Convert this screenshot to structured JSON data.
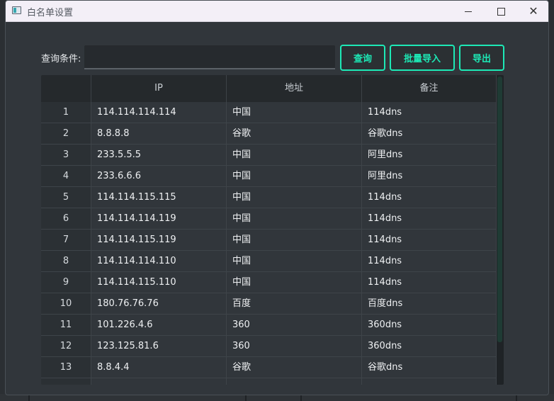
{
  "window": {
    "title": "白名单设置"
  },
  "query": {
    "label": "查询条件:",
    "value": "",
    "placeholder": "",
    "buttons": {
      "query": "查询",
      "batch_import": "批量导入",
      "export": "导出"
    }
  },
  "table": {
    "columns": [
      "IP",
      "地址",
      "备注"
    ],
    "rows": [
      {
        "index": "1",
        "ip": "114.114.114.114",
        "address": "中国",
        "note": "114dns"
      },
      {
        "index": "2",
        "ip": "8.8.8.8",
        "address": "谷歌",
        "note": "谷歌dns"
      },
      {
        "index": "3",
        "ip": "233.5.5.5",
        "address": "中国",
        "note": "阿里dns"
      },
      {
        "index": "4",
        "ip": "233.6.6.6",
        "address": "中国",
        "note": "阿里dns"
      },
      {
        "index": "5",
        "ip": "114.114.115.115",
        "address": "中国",
        "note": "114dns"
      },
      {
        "index": "6",
        "ip": "114.114.114.119",
        "address": "中国",
        "note": "114dns"
      },
      {
        "index": "7",
        "ip": "114.114.115.119",
        "address": "中国",
        "note": "114dns"
      },
      {
        "index": "8",
        "ip": "114.114.114.110",
        "address": "中国",
        "note": "114dns"
      },
      {
        "index": "9",
        "ip": "114.114.115.110",
        "address": "中国",
        "note": "114dns"
      },
      {
        "index": "10",
        "ip": "180.76.76.76",
        "address": "百度",
        "note": "百度dns"
      },
      {
        "index": "11",
        "ip": "101.226.4.6",
        "address": "360",
        "note": "360dns"
      },
      {
        "index": "12",
        "ip": "123.125.81.6",
        "address": "360",
        "note": "360dns"
      },
      {
        "index": "13",
        "ip": "8.8.4.4",
        "address": "谷歌",
        "note": "谷歌dns"
      }
    ]
  },
  "colors": {
    "accent": "#1de9b6",
    "background": "#31363b",
    "titlebar": "#f3eff7"
  }
}
